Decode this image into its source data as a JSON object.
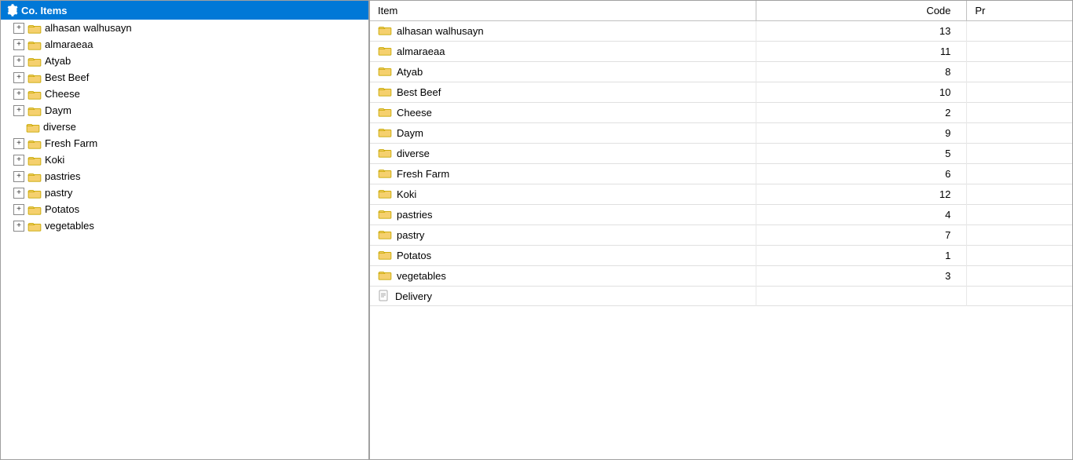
{
  "leftPanel": {
    "header": {
      "label": "Co. Items",
      "gearIcon": "⚙"
    },
    "items": [
      {
        "id": "alhasan",
        "label": "alhasan walhusayn",
        "expandable": true
      },
      {
        "id": "almaraeaa",
        "label": "almaraeaa",
        "expandable": true
      },
      {
        "id": "atyab",
        "label": "Atyab",
        "expandable": true
      },
      {
        "id": "bestbeef",
        "label": "Best Beef",
        "expandable": true
      },
      {
        "id": "cheese",
        "label": "Cheese",
        "expandable": true
      },
      {
        "id": "daym",
        "label": "Daym",
        "expandable": true
      },
      {
        "id": "diverse",
        "label": "diverse",
        "expandable": false
      },
      {
        "id": "freshfarm",
        "label": "Fresh Farm",
        "expandable": true
      },
      {
        "id": "koki",
        "label": "Koki",
        "expandable": true
      },
      {
        "id": "pastries",
        "label": "pastries",
        "expandable": true
      },
      {
        "id": "pastry",
        "label": "pastry",
        "expandable": true
      },
      {
        "id": "potatos",
        "label": "Potatos",
        "expandable": true
      },
      {
        "id": "vegetables",
        "label": "vegetables",
        "expandable": true
      }
    ]
  },
  "rightPanel": {
    "columns": [
      {
        "id": "item",
        "label": "Item"
      },
      {
        "id": "code",
        "label": "Code"
      },
      {
        "id": "pr",
        "label": "Pr"
      }
    ],
    "rows": [
      {
        "id": "alhasan",
        "item": "alhasan walhusayn",
        "code": "13",
        "isFolder": true
      },
      {
        "id": "almaraeaa",
        "item": "almaraeaa",
        "code": "11",
        "isFolder": true
      },
      {
        "id": "atyab",
        "item": "Atyab",
        "code": "8",
        "isFolder": true
      },
      {
        "id": "bestbeef",
        "item": "Best Beef",
        "code": "10",
        "isFolder": true
      },
      {
        "id": "cheese",
        "item": "Cheese",
        "code": "2",
        "isFolder": true
      },
      {
        "id": "daym",
        "item": "Daym",
        "code": "9",
        "isFolder": true
      },
      {
        "id": "diverse",
        "item": "diverse",
        "code": "5",
        "isFolder": true
      },
      {
        "id": "freshfarm",
        "item": "Fresh Farm",
        "code": "6",
        "isFolder": true
      },
      {
        "id": "koki",
        "item": "Koki",
        "code": "12",
        "isFolder": true
      },
      {
        "id": "pastries",
        "item": "pastries",
        "code": "4",
        "isFolder": true
      },
      {
        "id": "pastry",
        "item": "pastry",
        "code": "7",
        "isFolder": true
      },
      {
        "id": "potatos",
        "item": "Potatos",
        "code": "1",
        "isFolder": true
      },
      {
        "id": "vegetables",
        "item": "vegetables",
        "code": "3",
        "isFolder": true
      },
      {
        "id": "delivery",
        "item": "Delivery",
        "code": "",
        "isFolder": false
      }
    ]
  },
  "expandLabel": "+",
  "icons": {
    "gear": "⚙"
  }
}
